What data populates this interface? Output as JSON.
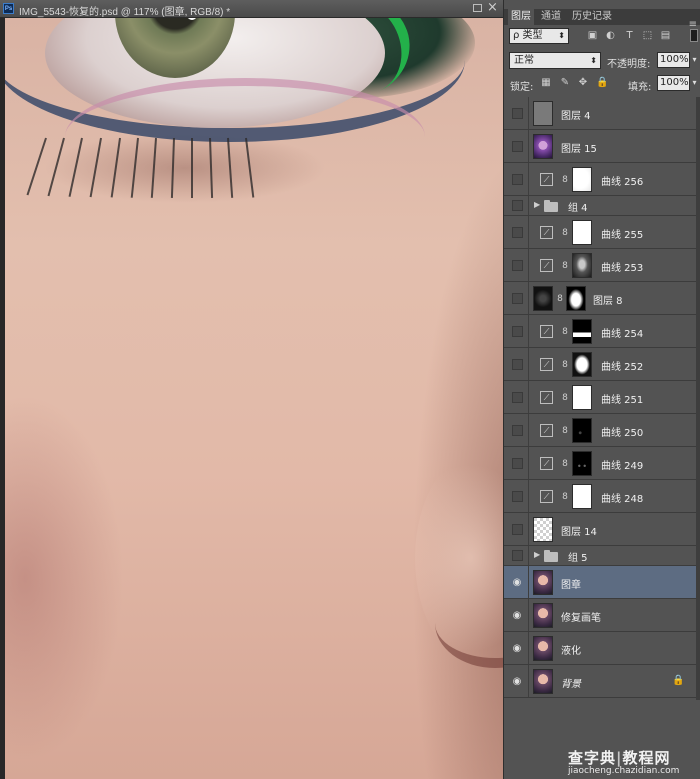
{
  "document": {
    "title": "IMG_5543-恢复的.psd @ 117% (图章, RGB/8) *",
    "app_badge": "Ps",
    "close_glyph": "×"
  },
  "panel": {
    "tabs": [
      "图层",
      "通道",
      "历史记录"
    ],
    "active_tab": "图层",
    "menu_glyph": "≡",
    "filter": {
      "kind_label": "ρ 类型",
      "icons": [
        "image-filter-icon",
        "adjustment-filter-icon",
        "type-filter-icon",
        "shape-filter-icon",
        "smart-object-filter-icon"
      ]
    },
    "blend": {
      "mode": "正常",
      "opacity_label": "不透明度:",
      "opacity_value": "100%"
    },
    "lock": {
      "label": "锁定:",
      "icons": [
        "lock-transparent-icon",
        "lock-brush-icon",
        "lock-move-icon",
        "lock-all-icon"
      ],
      "fill_label": "填充:",
      "fill_value": "100%"
    },
    "layers": [
      {
        "name": "图层 4",
        "kind": "pixel",
        "thumb": "gray",
        "visible": false
      },
      {
        "name": "图层 15",
        "kind": "pixel",
        "thumb": "portrait-purple",
        "visible": false
      },
      {
        "name": "曲线 256",
        "kind": "curves",
        "mask": "white-soft",
        "visible": false
      },
      {
        "name": "组 4",
        "kind": "group",
        "visible": false
      },
      {
        "name": "曲线 255",
        "kind": "curves",
        "mask": "white",
        "visible": false
      },
      {
        "name": "曲线 253",
        "kind": "curves",
        "mask": "face",
        "visible": false
      },
      {
        "name": "图层 8",
        "kind": "pixel-mask",
        "thumb": "dark",
        "mask": "blob",
        "visible": false
      },
      {
        "name": "曲线 254",
        "kind": "curves",
        "mask": "half",
        "visible": false
      },
      {
        "name": "曲线 252",
        "kind": "curves",
        "mask": "cloud",
        "visible": false
      },
      {
        "name": "曲线 251",
        "kind": "curves",
        "mask": "white",
        "visible": false
      },
      {
        "name": "曲线 250",
        "kind": "curves",
        "mask": "black-dots",
        "visible": false
      },
      {
        "name": "曲线 249",
        "kind": "curves",
        "mask": "black-eyes",
        "visible": false
      },
      {
        "name": "曲线 248",
        "kind": "curves",
        "mask": "white",
        "visible": false
      },
      {
        "name": "图层 14",
        "kind": "pixel",
        "thumb": "checker",
        "visible": false
      },
      {
        "name": "组 5",
        "kind": "group",
        "visible": false
      },
      {
        "name": "图章",
        "kind": "pixel",
        "thumb": "portrait",
        "visible": true,
        "selected": true
      },
      {
        "name": "修复画笔",
        "kind": "pixel",
        "thumb": "portrait",
        "visible": true
      },
      {
        "name": "液化",
        "kind": "pixel",
        "thumb": "portrait",
        "visible": true
      },
      {
        "name": "背景",
        "kind": "background",
        "thumb": "portrait",
        "visible": true,
        "locked": true
      }
    ]
  },
  "watermark": {
    "line1_a": "查字典",
    "line1_sep": "|",
    "line1_b": "教程网",
    "line2": "jiaocheng.chazidian.com"
  },
  "colors": {
    "panel_bg": "#535353",
    "selected_layer": "#5d6c82",
    "eyeliner_green": "#23b14a"
  }
}
